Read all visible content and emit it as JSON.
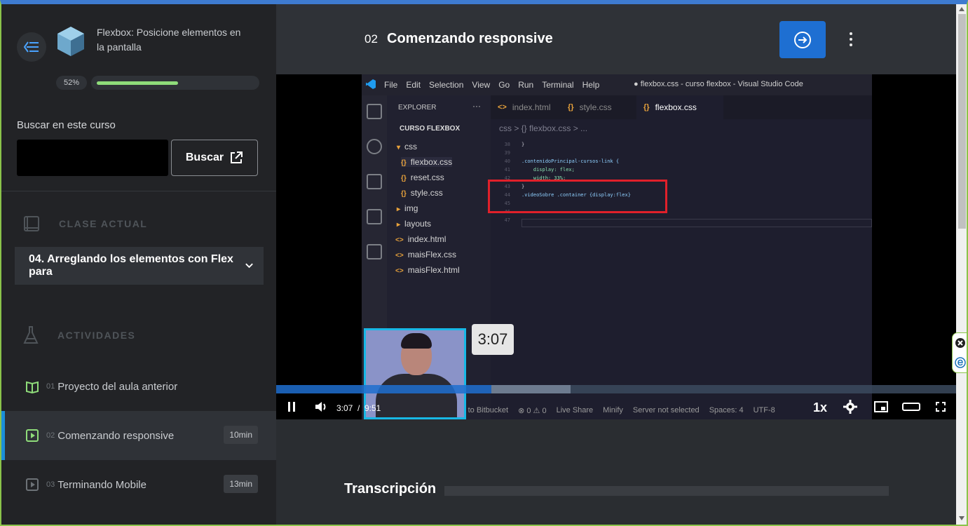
{
  "course": {
    "title": "Flexbox: Posicione elementos en la pantalla",
    "progress_label": "52%",
    "progress_value": 0.52
  },
  "search": {
    "label": "Buscar en este curso",
    "input_value": "",
    "button_label": "Buscar"
  },
  "current_class": {
    "heading": "CLASE ACTUAL",
    "selected": "04. Arreglando los elementos con Flex para"
  },
  "activities": {
    "heading": "ACTIVIDADES",
    "items": [
      {
        "num": "01",
        "name": "Proyecto del aula anterior",
        "duration": ""
      },
      {
        "num": "02",
        "name": "Comenzando responsive",
        "duration": "10min"
      },
      {
        "num": "03",
        "name": "Terminando Mobile",
        "duration": "13min"
      }
    ]
  },
  "lesson": {
    "number": "02",
    "title": "Comenzando responsive"
  },
  "video": {
    "hover_time": "3:07",
    "current_time": "3:07",
    "separator": "/",
    "duration": "9:51",
    "played_fraction": 0.316,
    "buffered_fraction": 0.433,
    "speed": "1x"
  },
  "vscode": {
    "menu": [
      "File",
      "Edit",
      "Selection",
      "View",
      "Go",
      "Run",
      "Terminal",
      "Help"
    ],
    "window_title": "● flexbox.css - curso flexbox - Visual Studio Code",
    "explorer_title": "EXPLORER",
    "explorer_more": "···",
    "folder": "CURSO FLEXBOX",
    "tree": [
      {
        "name": "css",
        "icon": "▾"
      },
      {
        "name": "flexbox.css",
        "icon": "{}"
      },
      {
        "name": "reset.css",
        "icon": "{}"
      },
      {
        "name": "style.css",
        "icon": "{}"
      },
      {
        "name": "img",
        "icon": "▸"
      },
      {
        "name": "layouts",
        "icon": "▸"
      },
      {
        "name": "index.html",
        "icon": "<>"
      },
      {
        "name": "maisFlex.css",
        "icon": "<>"
      },
      {
        "name": "maisFlex.html",
        "icon": "<>"
      }
    ],
    "tabs": [
      {
        "label": "index.html",
        "icon": "<>"
      },
      {
        "label": "style.css",
        "icon": "{}"
      },
      {
        "label": "flexbox.css",
        "icon": "{}"
      }
    ],
    "breadcrumb": "css > {} flexbox.css > ...",
    "lines": [
      {
        "n": "38",
        "code": "}"
      },
      {
        "n": "39",
        "code": ""
      },
      {
        "n": "40",
        "code": ".contenidoPrincipal-cursos-link {"
      },
      {
        "n": "41",
        "code": "    display: flex;"
      },
      {
        "n": "42",
        "code": "    width: 33%;"
      },
      {
        "n": "43",
        "code": "}"
      },
      {
        "n": "44",
        "code": ".videoSobre .container {display:flex}"
      },
      {
        "n": "45",
        "code": ""
      },
      {
        "n": "46",
        "code": ""
      },
      {
        "n": "47",
        "code": ""
      }
    ],
    "status": [
      "in to Bitbucket",
      "⊗ 0 ⚠ 0",
      "Live Share",
      "Minify",
      "Server not selected",
      "Spaces: 4",
      "UTF-8"
    ]
  },
  "transcript": {
    "title": "Transcripción"
  },
  "colors": {
    "accent": "#1e6fd2",
    "progress": "#8fdc7a",
    "highlight_box": "#e0202a",
    "active_indicator": "#1b8fd8"
  }
}
